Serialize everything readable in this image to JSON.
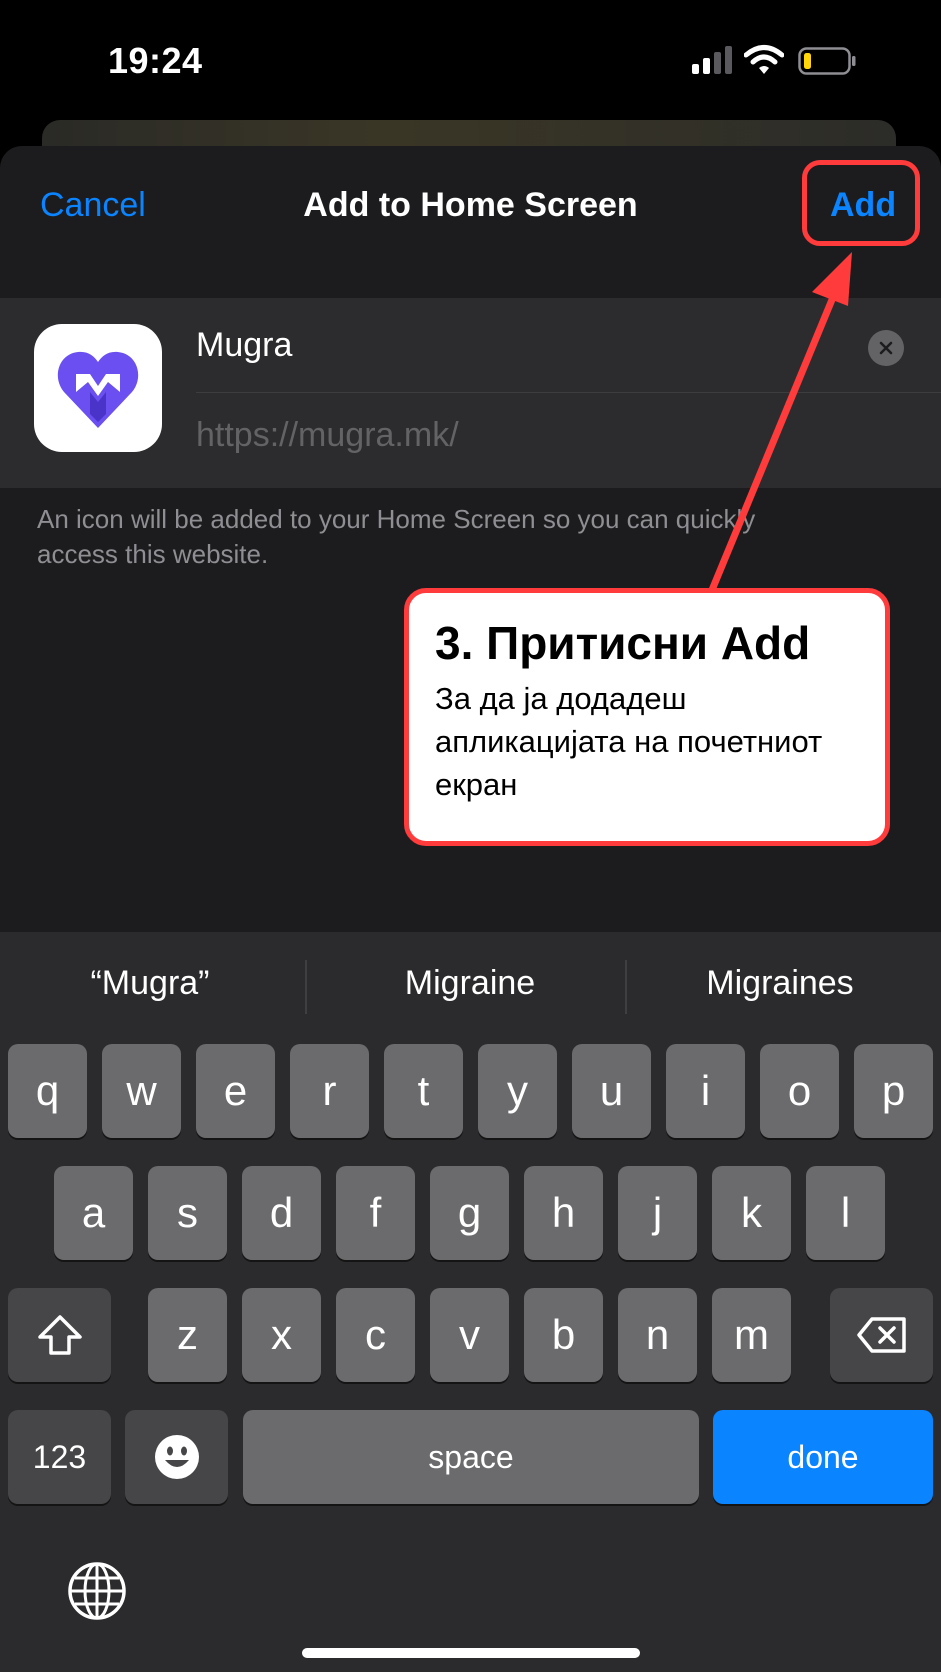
{
  "status_bar": {
    "time": "19:24"
  },
  "sheet": {
    "cancel_label": "Cancel",
    "title": "Add to Home Screen",
    "add_label": "Add",
    "app_name": "Mugra",
    "url": "https://mugra.mk/",
    "info_text": "An icon will be added to your Home Screen so you can quickly access this website."
  },
  "callout": {
    "title": "3. Притисни Add",
    "body": "За да ја додадеш апликацијата на почетниот екран"
  },
  "keyboard": {
    "suggestions": [
      "“Mugra”",
      "Migraine",
      "Migraines"
    ],
    "row1": [
      "q",
      "w",
      "e",
      "r",
      "t",
      "y",
      "u",
      "i",
      "o",
      "p"
    ],
    "row2": [
      "a",
      "s",
      "d",
      "f",
      "g",
      "h",
      "j",
      "k",
      "l"
    ],
    "row3": [
      "z",
      "x",
      "c",
      "v",
      "b",
      "n",
      "m"
    ],
    "num_label": "123",
    "space_label": "space",
    "done_label": "done"
  },
  "colors": {
    "accent": "#0a84ff",
    "highlight": "#ff3b3b",
    "brand": "#6b4ff0"
  },
  "icons": [
    "signal-icon",
    "wifi-icon",
    "battery-icon",
    "clear-icon",
    "app-logo-icon",
    "shift-icon",
    "delete-icon",
    "emoji-icon",
    "globe-icon"
  ]
}
